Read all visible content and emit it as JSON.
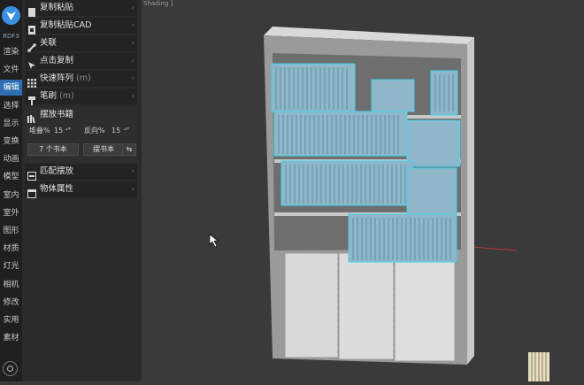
{
  "app": {
    "brand": "RDF3"
  },
  "nav": [
    {
      "label": "渲染",
      "active": false
    },
    {
      "label": "文件",
      "active": false
    },
    {
      "label": "编辑",
      "active": true
    },
    {
      "label": "选择",
      "active": false
    },
    {
      "label": "显示",
      "active": false
    },
    {
      "label": "变换",
      "active": false
    },
    {
      "label": "动画",
      "active": false
    },
    {
      "label": "模型",
      "active": false
    },
    {
      "label": "室内",
      "active": false
    },
    {
      "label": "室外",
      "active": false
    },
    {
      "label": "图形",
      "active": false
    },
    {
      "label": "材质",
      "active": false
    },
    {
      "label": "灯光",
      "active": false
    },
    {
      "label": "相机",
      "active": false
    },
    {
      "label": "修改",
      "active": false
    },
    {
      "label": "实用",
      "active": false
    },
    {
      "label": "素材",
      "active": false
    }
  ],
  "panel": {
    "copy_paste": "复制粘贴",
    "copy_paste_cad": "复制粘贴CAD",
    "link": "关联",
    "click_copy": "点击复制",
    "quick_array": "快速阵列",
    "quick_array_key": "(m)",
    "brush": "笔刷",
    "brush_key": "(m)",
    "place_books": "摆放书籍",
    "stack_label": "堆叠%",
    "stack_value": "15",
    "reverse_label": "反向%",
    "reverse_value": "15",
    "books_count_btn": "7 个书本",
    "place_book_btn": "摆书本",
    "match_place": "匹配摆放",
    "object_props": "物体属性"
  },
  "viewport": {
    "label": "Shading ]"
  },
  "colors": {
    "active_nav": "#2d6db2",
    "selection": "#41d3f0",
    "panel_bg": "#2b2b2b",
    "viewport_bg": "#3a3a3a"
  }
}
